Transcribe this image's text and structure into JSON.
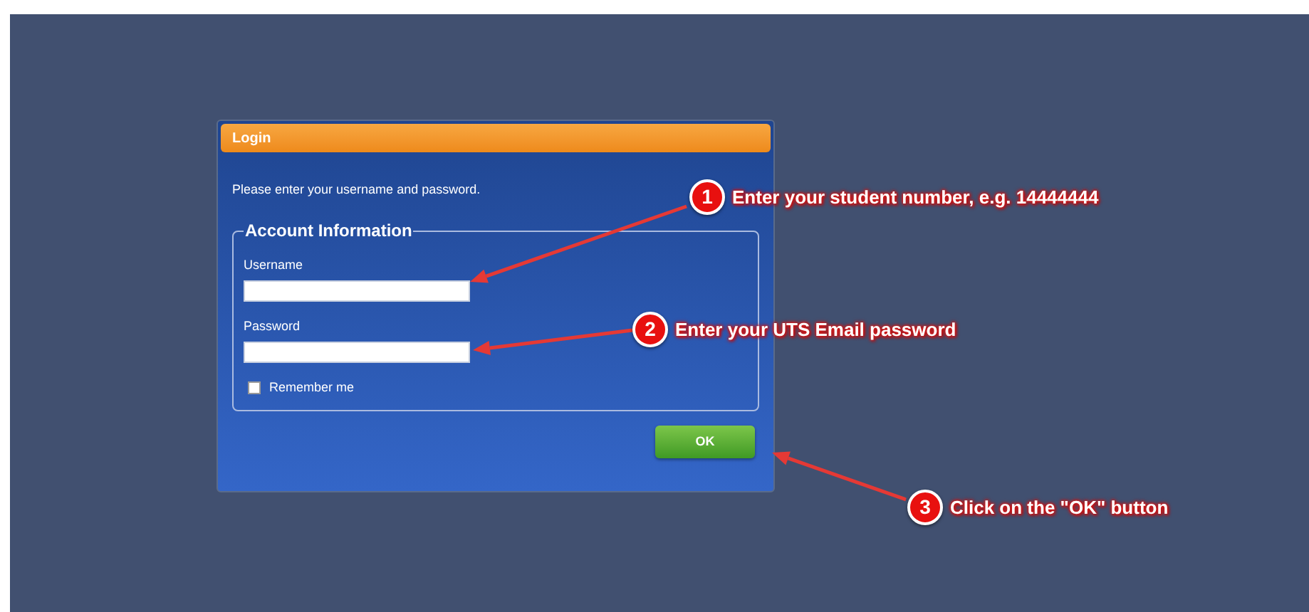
{
  "dialog": {
    "title": "Login",
    "prompt": "Please enter your username and password.",
    "fieldset": {
      "legend": "Account Information",
      "fields": [
        {
          "label": "Username"
        },
        {
          "label": "Password"
        }
      ],
      "remember": {
        "label": "Remember me",
        "checked": false
      }
    },
    "ok_button": "OK"
  },
  "annotations": [
    {
      "number": "1",
      "text": "Enter your student number, e.g. 14444444"
    },
    {
      "number": "2",
      "text": "Enter your UTS Email password"
    },
    {
      "number": "3",
      "text": "Click on the \"OK\" button"
    }
  ]
}
